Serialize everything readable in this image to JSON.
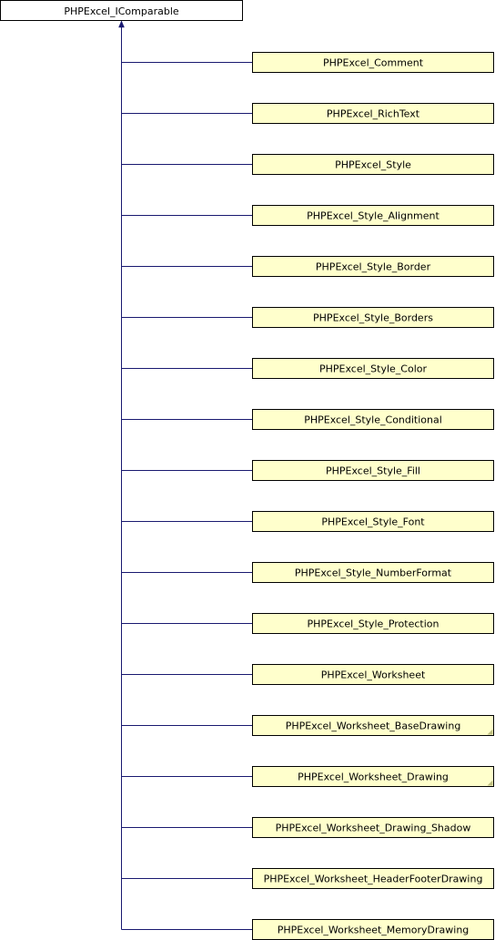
{
  "diagram": {
    "root": {
      "label": "PHPExcel_IComparable"
    },
    "children": [
      {
        "label": "PHPExcel_Comment",
        "folded": false
      },
      {
        "label": "PHPExcel_RichText",
        "folded": false
      },
      {
        "label": "PHPExcel_Style",
        "folded": false
      },
      {
        "label": "PHPExcel_Style_Alignment",
        "folded": false
      },
      {
        "label": "PHPExcel_Style_Border",
        "folded": false
      },
      {
        "label": "PHPExcel_Style_Borders",
        "folded": false
      },
      {
        "label": "PHPExcel_Style_Color",
        "folded": false
      },
      {
        "label": "PHPExcel_Style_Conditional",
        "folded": false
      },
      {
        "label": "PHPExcel_Style_Fill",
        "folded": false
      },
      {
        "label": "PHPExcel_Style_Font",
        "folded": false
      },
      {
        "label": "PHPExcel_Style_NumberFormat",
        "folded": false
      },
      {
        "label": "PHPExcel_Style_Protection",
        "folded": false
      },
      {
        "label": "PHPExcel_Worksheet",
        "folded": false
      },
      {
        "label": "PHPExcel_Worksheet_BaseDrawing",
        "folded": true
      },
      {
        "label": "PHPExcel_Worksheet_Drawing",
        "folded": true
      },
      {
        "label": "PHPExcel_Worksheet_Drawing_Shadow",
        "folded": false
      },
      {
        "label": "PHPExcel_Worksheet_HeaderFooterDrawing",
        "folded": false
      },
      {
        "label": "PHPExcel_Worksheet_MemoryDrawing",
        "folded": false
      }
    ],
    "colors": {
      "root_fill": "#ffffff",
      "child_fill": "#ffffcc",
      "node_border": "#000000",
      "edge": "#191970",
      "fold_marker": "#bfbf80"
    }
  }
}
